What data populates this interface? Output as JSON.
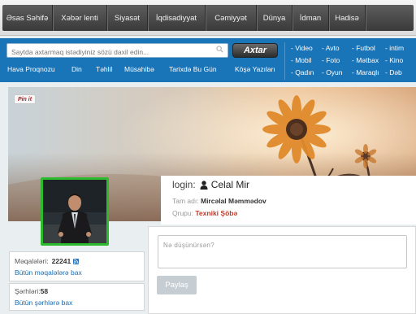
{
  "topnav": {
    "items": [
      "Əsas Səhifə",
      "Xəbər lenti",
      "Siyasət",
      "İqdisadiyyat",
      "Cəmiyyət",
      "Dünya",
      "İdman",
      "Hadisə"
    ]
  },
  "search": {
    "placeholder": "Saytda axtarmaq istədiyiniz sözü daxil edin...",
    "button_label": "Axtar"
  },
  "categories": [
    "Hava Proqnozu",
    "Din",
    "Təhlil",
    "Müsahibə",
    "Tarixdə Bu Gün",
    "Köşə Yazıları"
  ],
  "quicklinks": [
    [
      "- Video",
      "- Avto",
      "- Futbol",
      "- intim"
    ],
    [
      "- Mobil",
      "- Foto",
      "- Mətbax",
      "- Kino"
    ],
    [
      "- Qadın",
      "- Oyun",
      "- Maraqlı",
      "- Dəb"
    ]
  ],
  "pinit_label": "Pin it",
  "profile": {
    "login_label": "login:",
    "username": "Celal Mir",
    "fullname_label": "Tam adı:",
    "fullname": "Mircəlal Məmmədov",
    "group_label": "Qrupu:",
    "group": "Texniki Şöbə"
  },
  "post": {
    "placeholder": "Nə düşünürsən?",
    "button_label": "Paylaş"
  },
  "stats": {
    "articles_label": "Məqalələri:",
    "articles_count": "22241",
    "articles_link": "Bütün məqalələrə bax",
    "comments_label": "Şərhləri:",
    "comments_count": "58",
    "comments_link": "Bütün şərhlərə bax"
  },
  "colors": {
    "blue_bar": "#1a74b8",
    "avatar_border": "#2cbb2c",
    "group_color": "#c0392b",
    "link_color": "#1a6bb0"
  }
}
